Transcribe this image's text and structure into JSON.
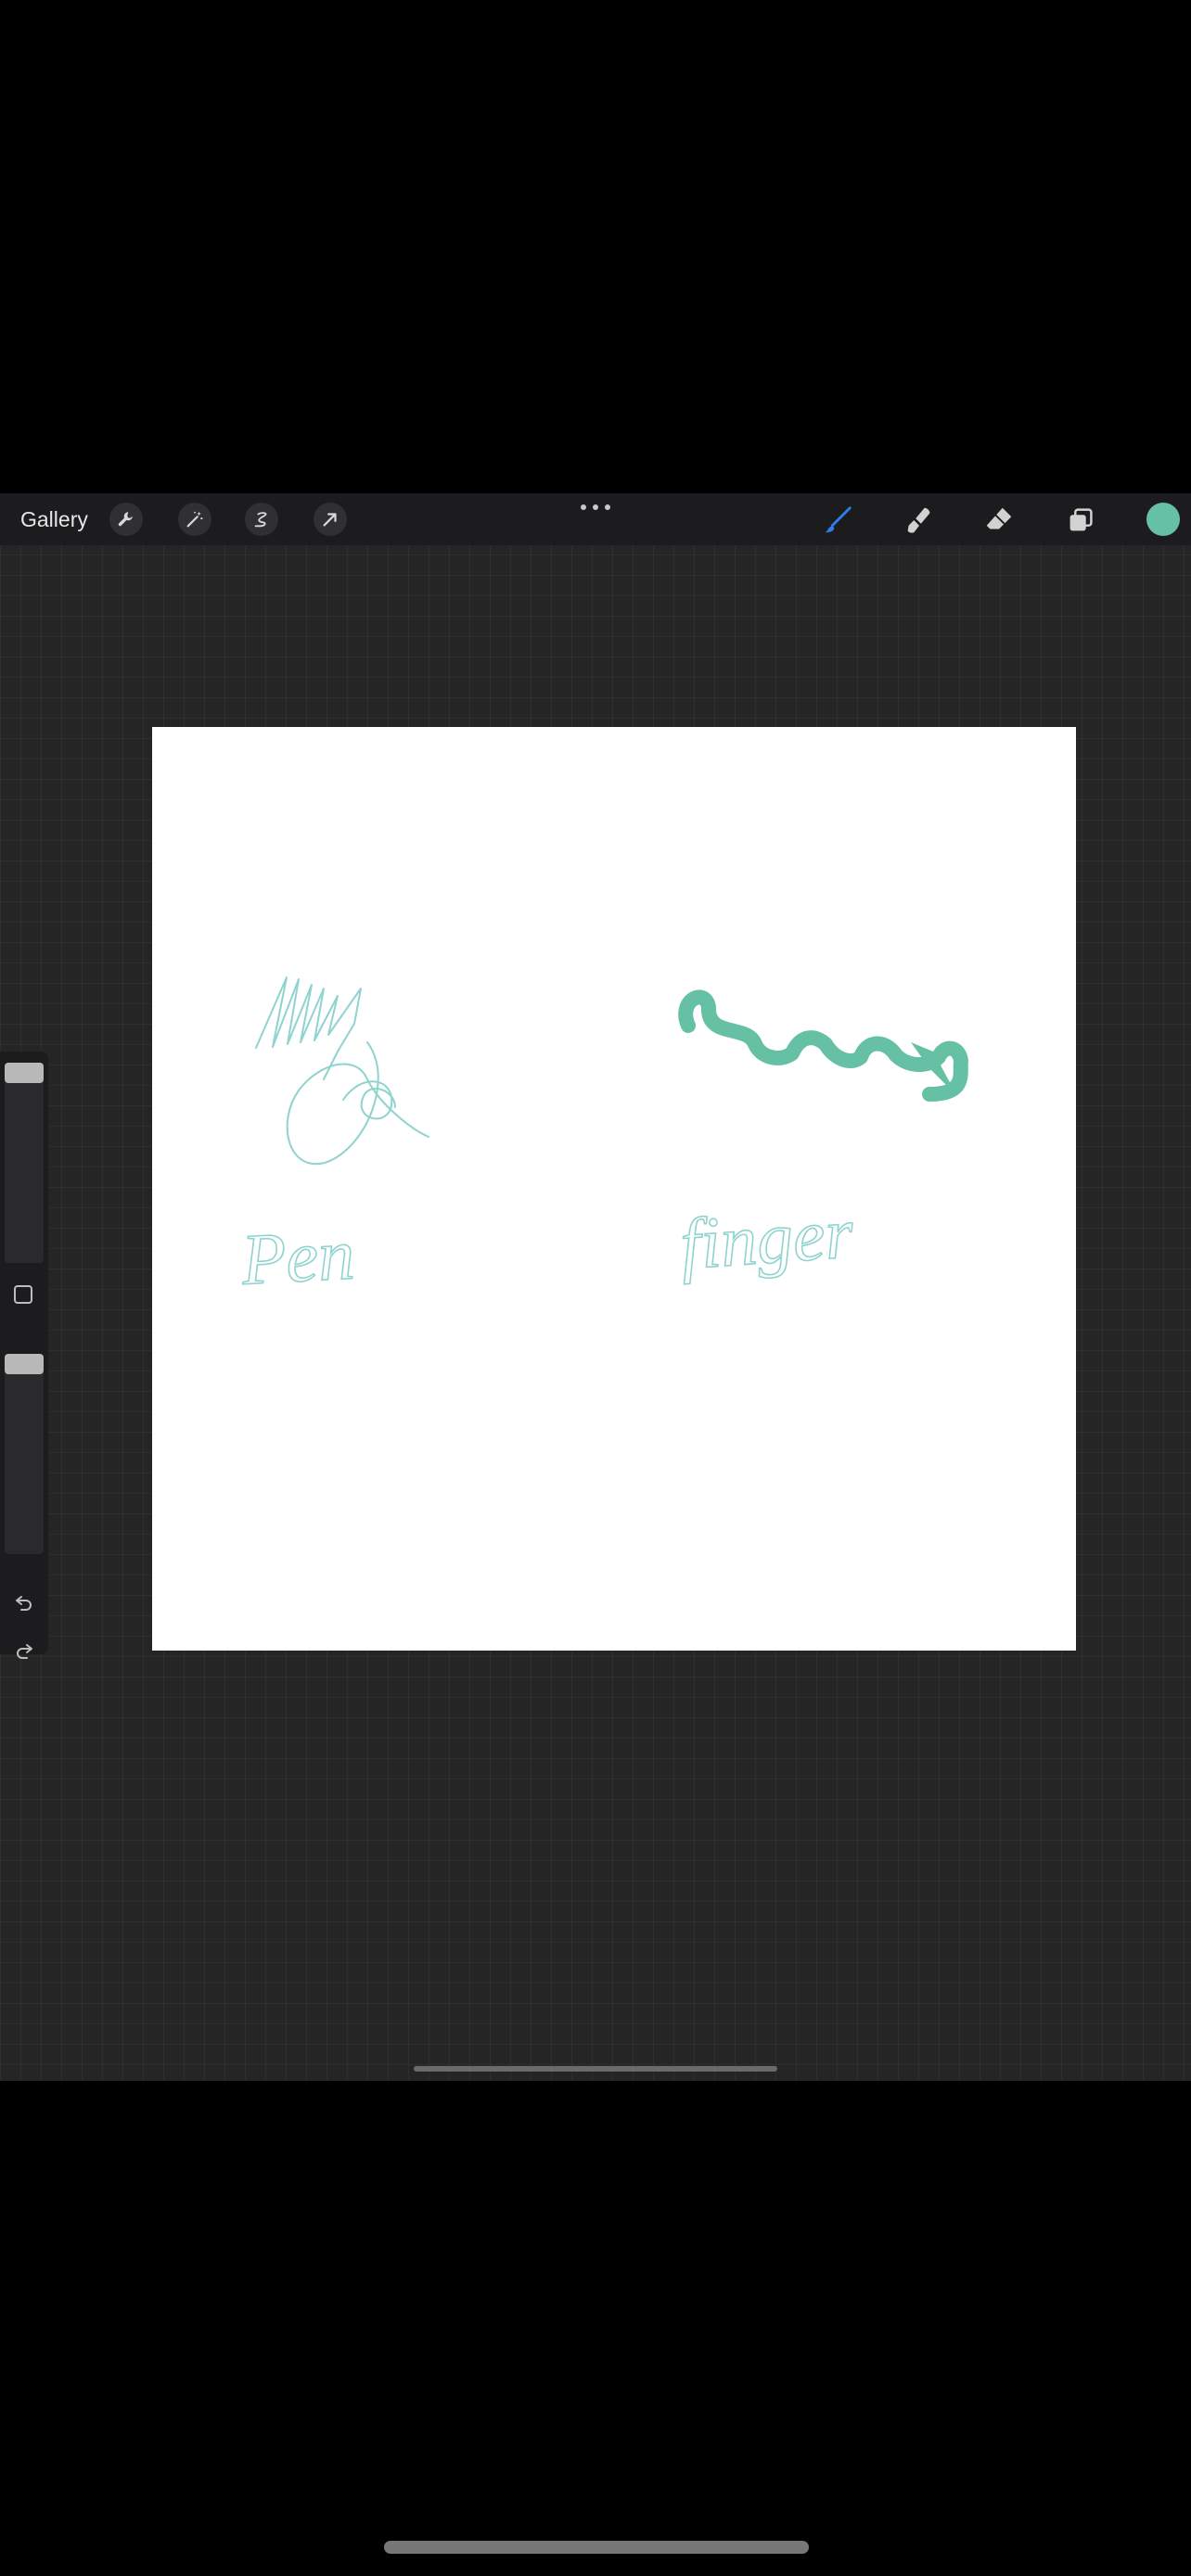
{
  "toolbar": {
    "gallery_label": "Gallery",
    "left_tools": [
      "wrench-icon",
      "magic-wand-icon",
      "selection-icon",
      "transform-arrow-icon"
    ],
    "right_tools": [
      "brush-icon",
      "smudge-icon",
      "eraser-icon",
      "layers-icon"
    ],
    "active_tool": "brush-icon"
  },
  "colors": {
    "current_color": "#66c1a4",
    "active_tool_color": "#2f7ef0",
    "inactive_tool_color": "#d2d2d2",
    "canvas_bg": "#ffffff",
    "app_bg": "#252525",
    "toolbar_bg": "#1c1c1e",
    "pen_stroke": "#8fd3cf",
    "finger_stroke": "#66c1a4"
  },
  "sidebar": {
    "brush_size_level": 0.0,
    "opacity_level": 0.0,
    "icons": [
      "modify-square-icon",
      "undo-icon",
      "redo-icon"
    ]
  },
  "canvas": {
    "labels": {
      "pen": "Pen",
      "finger": "finger"
    }
  }
}
